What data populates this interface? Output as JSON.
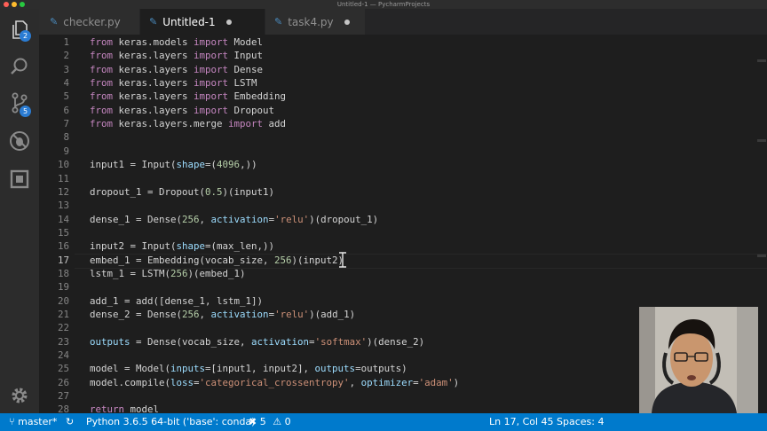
{
  "window": {
    "title": "Untitled-1 — PycharmProjects"
  },
  "activity_bar": {
    "explorer_badge": "2",
    "scm_badge": "5"
  },
  "tabs": [
    {
      "label": "checker.py",
      "dirty": false
    },
    {
      "label": "Untitled-1",
      "dirty": true,
      "active": true
    },
    {
      "label": "task4.py",
      "dirty": true
    }
  ],
  "editor": {
    "lines": [
      {
        "n": "1",
        "text": "from keras.models import Model"
      },
      {
        "n": "2",
        "text": "from keras.layers import Input"
      },
      {
        "n": "3",
        "text": "from keras.layers import Dense"
      },
      {
        "n": "4",
        "text": "from keras.layers import LSTM"
      },
      {
        "n": "5",
        "text": "from keras.layers import Embedding"
      },
      {
        "n": "6",
        "text": "from keras.layers import Dropout"
      },
      {
        "n": "7",
        "text": "from keras.layers.merge import add"
      },
      {
        "n": "8",
        "text": ""
      },
      {
        "n": "9",
        "text": ""
      },
      {
        "n": "10",
        "text": "input1 = Input(shape=(4096,))"
      },
      {
        "n": "11",
        "text": ""
      },
      {
        "n": "12",
        "text": "dropout_1 = Dropout(0.5)(input1)"
      },
      {
        "n": "13",
        "text": ""
      },
      {
        "n": "14",
        "text": "dense_1 = Dense(256, activation='relu')(dropout_1)"
      },
      {
        "n": "15",
        "text": ""
      },
      {
        "n": "16",
        "text": "input2 = Input(shape=(max_len,))"
      },
      {
        "n": "17",
        "text": "embed_1 = Embedding(vocab_size, 256)(input2)"
      },
      {
        "n": "18",
        "text": "lstm_1 = LSTM(256)(embed_1)"
      },
      {
        "n": "19",
        "text": ""
      },
      {
        "n": "20",
        "text": "add_1 = add([dense_1, lstm_1])"
      },
      {
        "n": "21",
        "text": "dense_2 = Dense(256, activation='relu')(add_1)"
      },
      {
        "n": "22",
        "text": ""
      },
      {
        "n": "23",
        "text": "outputs = Dense(vocab_size, activation='softmax')(dense_2)"
      },
      {
        "n": "24",
        "text": ""
      },
      {
        "n": "25",
        "text": "model = Model(inputs=[input1, input2], outputs=outputs)"
      },
      {
        "n": "26",
        "text": "model.compile(loss='categorical_crossentropy', optimizer='adam')"
      },
      {
        "n": "27",
        "text": ""
      },
      {
        "n": "28",
        "text": "return model"
      }
    ],
    "current_line": "17"
  },
  "status_bar": {
    "branch": "master*",
    "interpreter": "Python 3.6.5 64-bit ('base': conda)",
    "errors": "5",
    "warnings": "0",
    "cursor": "Ln 17, Col 45",
    "spaces": "Spaces: 4"
  },
  "colors": {
    "accent": "#007acc",
    "keyword": "#c586c0",
    "string": "#ce9178",
    "number": "#b5cea8",
    "param": "#9cdcfe"
  }
}
